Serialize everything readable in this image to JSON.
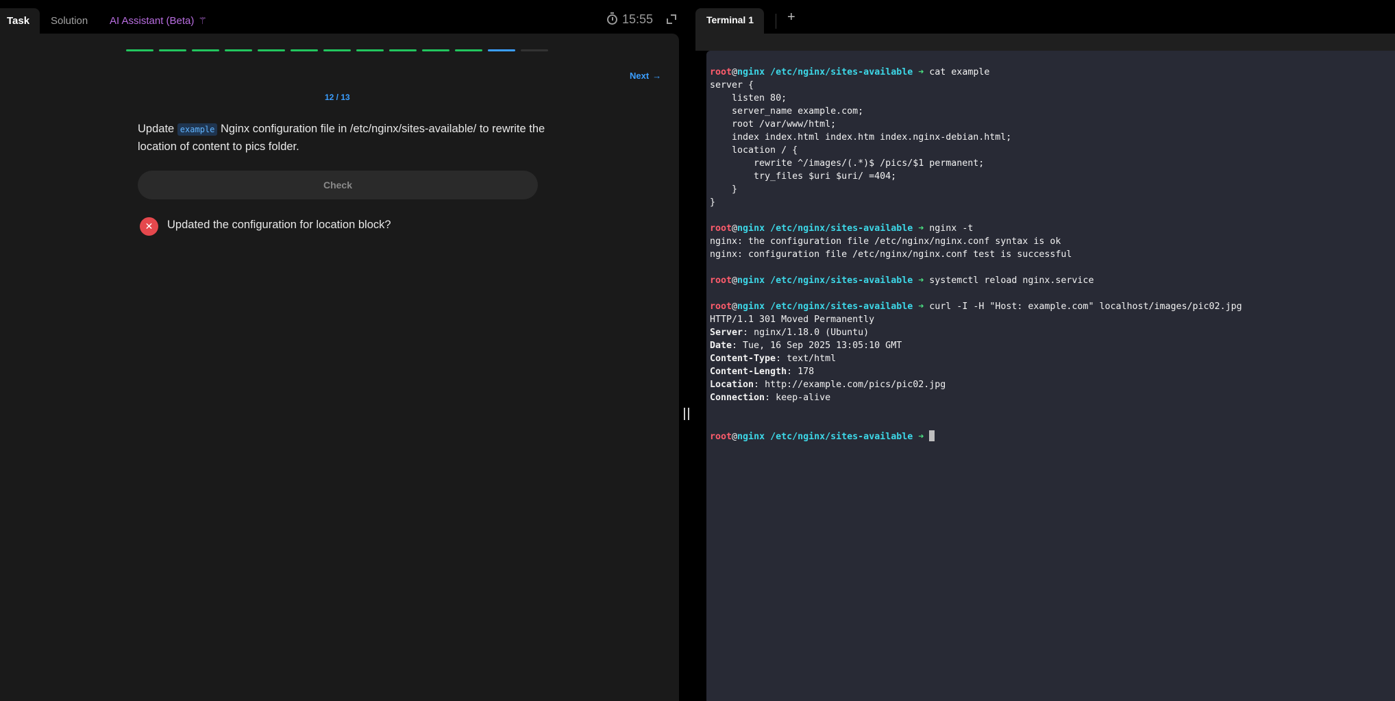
{
  "tabs": {
    "task": "Task",
    "solution": "Solution",
    "ai": "AI Assistant (Beta)"
  },
  "timer": "15:55",
  "progress": {
    "completed": 11,
    "current": 12,
    "total": 13
  },
  "nav": {
    "next": "Next"
  },
  "step": {
    "counter": "12 / 13"
  },
  "task": {
    "prefix": "Update ",
    "code": "example",
    "suffix": " Nginx configuration file in /etc/nginx/sites-available/ to rewrite the location of content to pics folder."
  },
  "check_button": "Check",
  "result": {
    "text": "Updated the configuration for location block?",
    "status": "failed"
  },
  "terminal": {
    "tab_label": "Terminal 1",
    "prompt": {
      "user": "root",
      "at": "@",
      "host": "nginx",
      "path": "/etc/nginx/sites-available",
      "arrow": "➜"
    },
    "lines": [
      {
        "kind": "cmd",
        "text": "cat example"
      },
      {
        "kind": "out",
        "text": "server {"
      },
      {
        "kind": "out",
        "text": "    listen 80;"
      },
      {
        "kind": "out",
        "text": "    server_name example.com;"
      },
      {
        "kind": "out",
        "text": "    root /var/www/html;"
      },
      {
        "kind": "out",
        "text": "    index index.html index.htm index.nginx-debian.html;"
      },
      {
        "kind": "out",
        "text": "    location / {"
      },
      {
        "kind": "out",
        "text": "        rewrite ^/images/(.*)$ /pics/$1 permanent;"
      },
      {
        "kind": "out",
        "text": "        try_files $uri $uri/ =404;"
      },
      {
        "kind": "out",
        "text": "    }"
      },
      {
        "kind": "out",
        "text": "}"
      },
      {
        "kind": "blank",
        "text": ""
      },
      {
        "kind": "cmd",
        "text": "nginx -t"
      },
      {
        "kind": "out",
        "text": "nginx: the configuration file /etc/nginx/nginx.conf syntax is ok"
      },
      {
        "kind": "out",
        "text": "nginx: configuration file /etc/nginx/nginx.conf test is successful"
      },
      {
        "kind": "blank",
        "text": ""
      },
      {
        "kind": "cmd",
        "text": "systemctl reload nginx.service"
      },
      {
        "kind": "blank",
        "text": ""
      },
      {
        "kind": "cmd",
        "text": "curl -I -H \"Host: example.com\" localhost/images/pic02.jpg"
      },
      {
        "kind": "out",
        "text": "HTTP/1.1 301 Moved Permanently"
      },
      {
        "kind": "hdr",
        "key": "Server",
        "text": "nginx/1.18.0 (Ubuntu)"
      },
      {
        "kind": "hdr",
        "key": "Date",
        "text": "Tue, 16 Sep 2025 13:05:10 GMT"
      },
      {
        "kind": "hdr",
        "key": "Content-Type",
        "text": "text/html"
      },
      {
        "kind": "hdr",
        "key": "Content-Length",
        "text": "178"
      },
      {
        "kind": "hdr",
        "key": "Location",
        "text": "http://example.com/pics/pic02.jpg"
      },
      {
        "kind": "hdr",
        "key": "Connection",
        "text": "keep-alive"
      },
      {
        "kind": "blank",
        "text": ""
      },
      {
        "kind": "blank",
        "text": ""
      },
      {
        "kind": "cmd",
        "text": "",
        "cursor": true
      }
    ]
  },
  "colors": {
    "accent": "#3b9eff",
    "success": "#22c55e",
    "error": "#e5484d",
    "ai": "#b86de0",
    "prompt_user": "#ff5c6c",
    "prompt_path": "#3dd8e8",
    "prompt_arrow": "#4ade80"
  }
}
